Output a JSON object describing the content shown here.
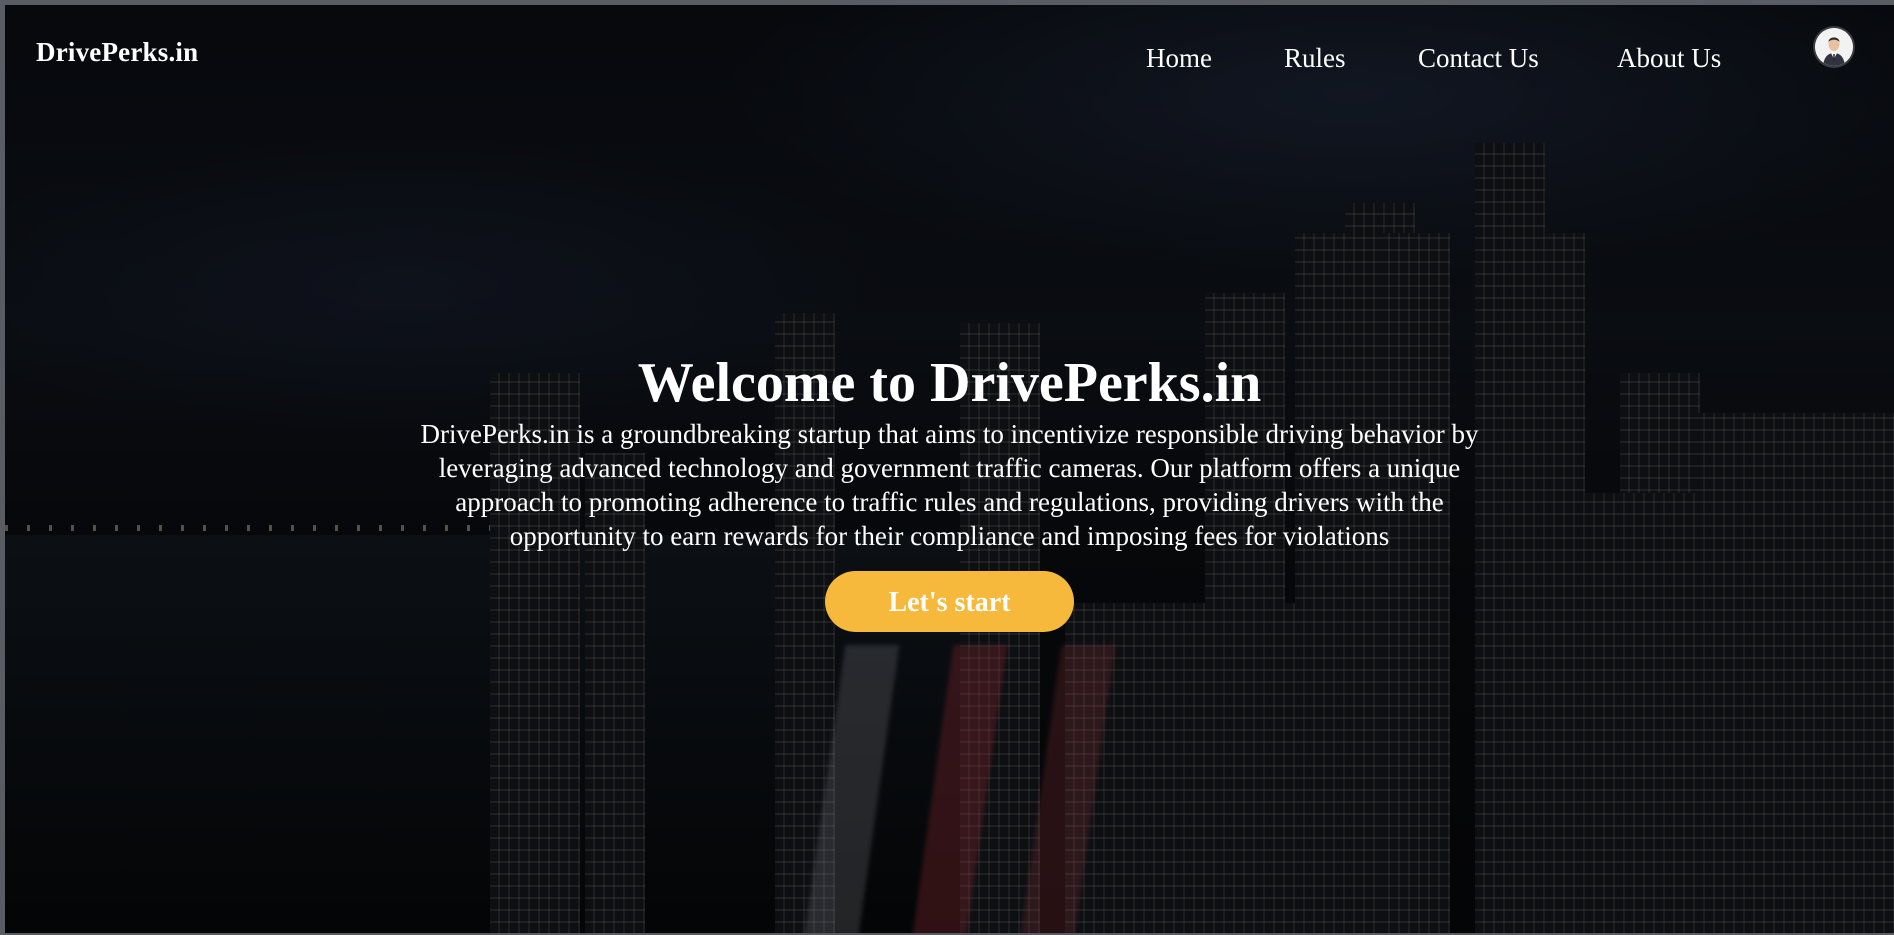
{
  "header": {
    "logo": "DrivePerks.in",
    "nav": {
      "home": "Home",
      "rules": "Rules",
      "contact": "Contact Us",
      "about": "About Us"
    },
    "avatar_icon": "user-avatar-icon"
  },
  "hero": {
    "title": "Welcome to DrivePerks.in",
    "description": "DrivePerks.in is a groundbreaking startup that aims to incentivize responsible driving behavior by leveraging advanced technology and government traffic cameras. Our platform offers a unique approach to promoting adherence to traffic rules and regulations, providing drivers with the opportunity to earn rewards for their compliance and imposing fees for violations",
    "cta_label": "Let's start"
  },
  "colors": {
    "accent": "#f6b93b",
    "text": "#ffffff",
    "background": "#07080b"
  }
}
